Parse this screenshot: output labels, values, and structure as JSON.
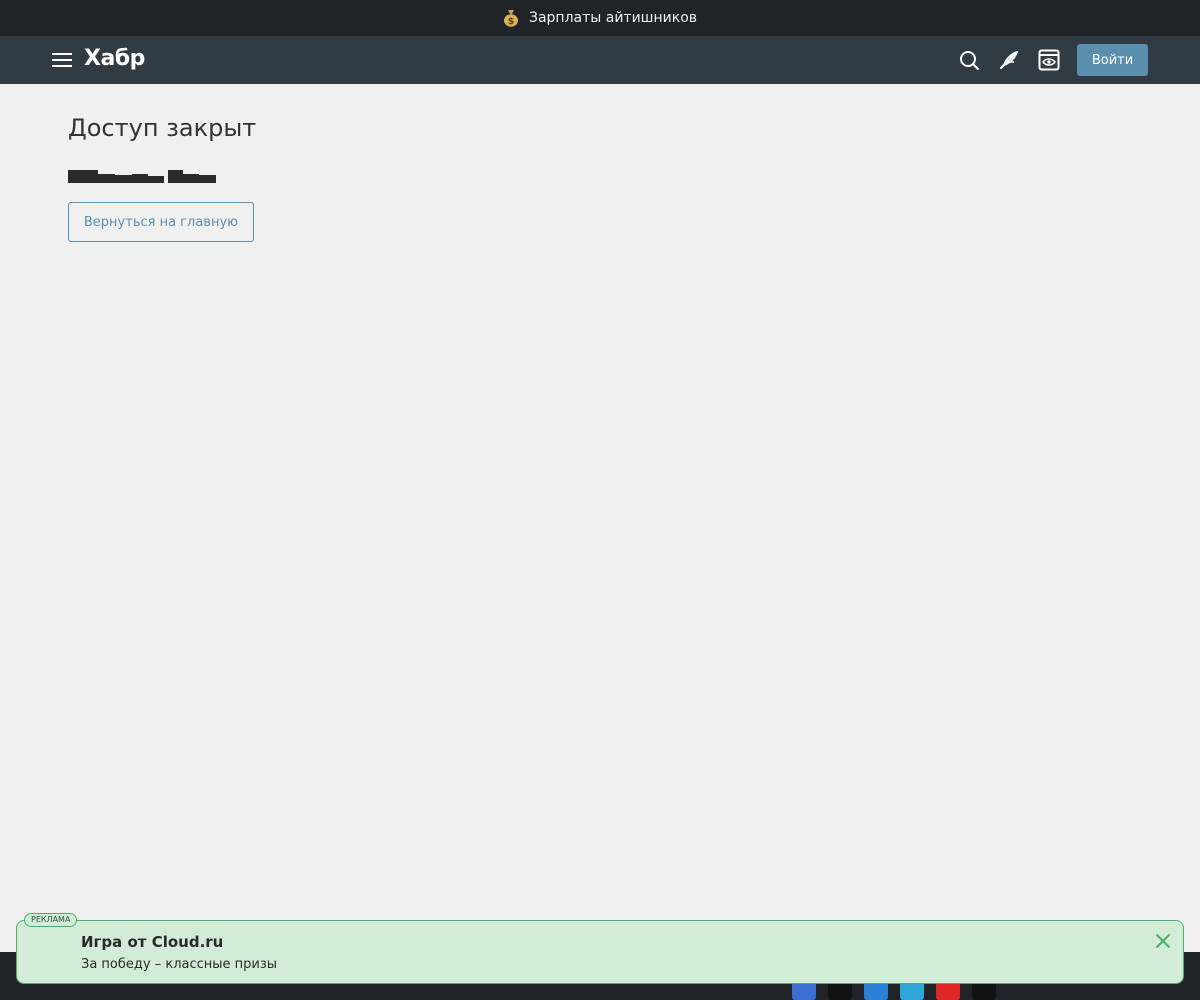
{
  "promo": {
    "text": "Зарплаты айтишников",
    "icon": "money-bag-icon"
  },
  "header": {
    "logo": "Хабр",
    "login_label": "Войти",
    "icons": [
      "menu-icon",
      "search-icon",
      "write-icon",
      "reader-mode-icon"
    ]
  },
  "main": {
    "title": "Доступ закрыт",
    "back_label": "Вернуться на главную"
  },
  "ad": {
    "badge": "РЕКЛАМА",
    "title": "Игра от Cloud.ru",
    "subtitle": "За победу – классные призы"
  },
  "colors": {
    "header_bg": "#303b44",
    "promo_bg": "#202428",
    "accent": "#5a8fae",
    "ad_bg": "#d2ecd8",
    "ad_border": "#4cae6a",
    "page_bg": "#f0f0f0"
  }
}
